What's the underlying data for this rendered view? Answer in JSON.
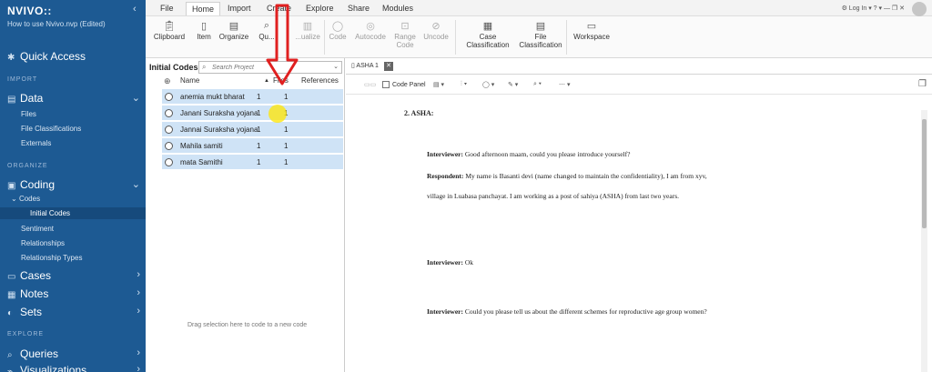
{
  "app": {
    "brand": "NVIVO",
    "brand_mark": "::",
    "project": "How to use Nvivo.nvp (Edited)"
  },
  "sidebar": {
    "quick_access": "Quick Access",
    "import_label": "IMPORT",
    "data": {
      "label": "Data",
      "items": [
        "Files",
        "File Classifications",
        "Externals"
      ]
    },
    "organize_label": "ORGANIZE",
    "coding": {
      "label": "Coding",
      "codes_label": "Codes",
      "initial_codes": "Initial Codes",
      "items": [
        "Sentiment",
        "Relationships",
        "Relationship Types"
      ]
    },
    "cases": "Cases",
    "notes": "Notes",
    "sets": "Sets",
    "explore_label": "EXPLORE",
    "queries": "Queries",
    "visualizations": "Visualizations"
  },
  "menubar": {
    "tabs": [
      "File",
      "Home",
      "Import",
      "Create",
      "Explore",
      "Share",
      "Modules"
    ],
    "active": "Home",
    "controls": "⚙ Log In  ▾  ?  ▾  —  ❐  ✕"
  },
  "ribbon": {
    "buttons": [
      {
        "label": "Clipboard",
        "icon": "clipboard-icon"
      },
      {
        "label": "Item",
        "icon": "item-icon"
      },
      {
        "label": "Organize",
        "icon": "organize-icon"
      },
      {
        "label": "Qu...",
        "icon": "query-icon"
      },
      {
        "label": "...ualize",
        "icon": "visualize-icon"
      },
      {
        "label": "Code",
        "icon": "code-icon"
      },
      {
        "label": "Autocode",
        "icon": "autocode-icon"
      },
      {
        "label": "Range",
        "label2": "Code",
        "icon": "range-code-icon"
      },
      {
        "label": "Uncode",
        "icon": "uncode-icon"
      },
      {
        "label": "Case",
        "label2": "Classification",
        "icon": "case-classification-icon"
      },
      {
        "label": "File",
        "label2": "Classification",
        "icon": "file-classification-icon"
      },
      {
        "label": "Workspace",
        "icon": "workspace-icon"
      }
    ]
  },
  "node_pane": {
    "title": "Initial Codes",
    "search_placeholder": "Search Project",
    "columns": {
      "name": "Name",
      "files": "Files",
      "references": "References"
    },
    "rows": [
      {
        "name": "anemia mukt bharat",
        "files": "1",
        "refs": "1"
      },
      {
        "name": "Janani Suraksha yojana",
        "files": "1",
        "refs": "1"
      },
      {
        "name": "Jannai Suraksha yojana",
        "files": "1",
        "refs": "1"
      },
      {
        "name": "Mahila samiti",
        "files": "1",
        "refs": "1"
      },
      {
        "name": "mata Samithi",
        "files": "1",
        "refs": "1"
      }
    ],
    "drag_hint": "Drag selection here to code to a new code"
  },
  "doc": {
    "tab": "ASHA 1",
    "code_panel": "Code Panel",
    "heading": "2. ASHA:",
    "paragraphs": [
      {
        "speaker": "Interviewer:",
        "text": " Good afternoon maam, could you please introduce yourself?"
      },
      {
        "speaker": "Respondent:",
        "text": " My name is Basanti devi (name changed to maintain the confidentiality), I am from xyv, village in Luabasa panchayat. I am working as a post of sahiya (ASHA) from last two years."
      },
      {
        "speaker": "Interviewer:",
        "text": " Ok"
      },
      {
        "speaker": "Interviewer:",
        "text": " Could you please tell us about the different schemes for reproductive age group women?"
      }
    ]
  }
}
